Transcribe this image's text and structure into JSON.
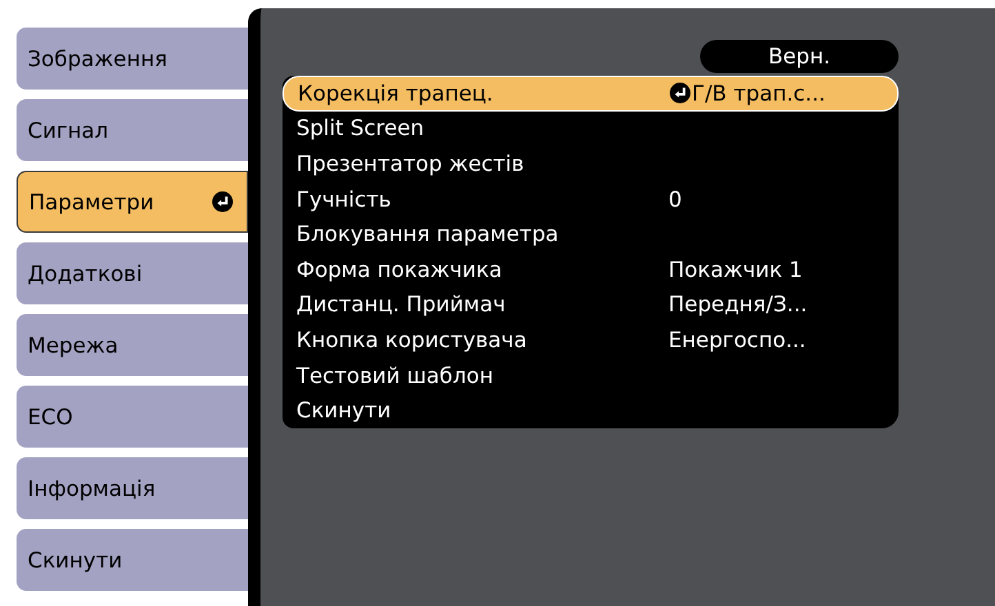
{
  "tabs": [
    {
      "label": "Зображення",
      "selected": false
    },
    {
      "label": "Сигнал",
      "selected": false
    },
    {
      "label": "Параметри",
      "selected": true
    },
    {
      "label": "Додаткові",
      "selected": false
    },
    {
      "label": "Мережа",
      "selected": false
    },
    {
      "label": "ECO",
      "selected": false
    },
    {
      "label": "Інформація",
      "selected": false
    },
    {
      "label": "Скинути",
      "selected": false
    }
  ],
  "back_button": "Верн.",
  "settings": [
    {
      "label": "Корекція трапец.",
      "value": "Г/В трап.с...",
      "selected": true
    },
    {
      "label": "Split Screen",
      "selected": false
    },
    {
      "label": "Презентатор жестів",
      "selected": false
    },
    {
      "label": "Гучність",
      "value": "0",
      "selected": false
    },
    {
      "label": "Блокування параметра",
      "selected": false
    },
    {
      "label": "Форма покажчика",
      "value": "Покажчик 1",
      "selected": false
    },
    {
      "label": "Дистанц. Приймач",
      "value": "Передня/З...",
      "selected": false
    },
    {
      "label": "Кнопка користувача",
      "value": "Енергоспо...",
      "selected": false
    },
    {
      "label": "Тестовий шаблон",
      "selected": false
    },
    {
      "label": "Скинути",
      "selected": false
    }
  ]
}
